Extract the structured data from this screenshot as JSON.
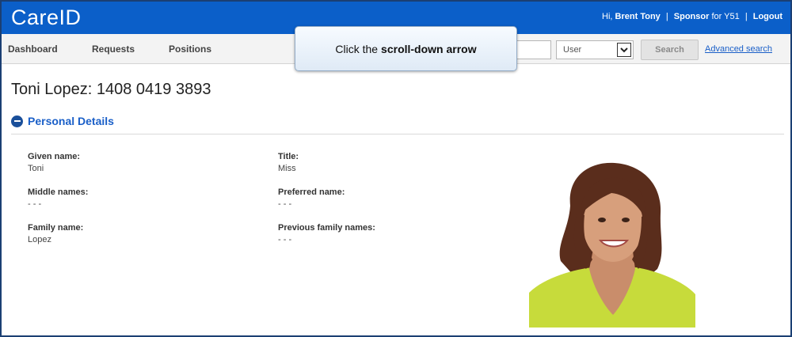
{
  "app": {
    "logo": "CareID"
  },
  "user": {
    "greeting": "Hi,",
    "name": "Brent Tony",
    "sep1": "|",
    "role_prefix": "Sponsor",
    "role_suffix": "for Y51",
    "sep2": "|",
    "logout": "Logout"
  },
  "nav": {
    "items": [
      {
        "label": "Dashboard"
      },
      {
        "label": "Requests"
      },
      {
        "label": "Positions"
      }
    ]
  },
  "search": {
    "input_value": "",
    "select_value": "User",
    "button_label": "Search",
    "advanced_link": "Advanced search"
  },
  "callout": {
    "prefix": "Click the",
    "emphasis": "scroll-down arrow"
  },
  "person": {
    "title": "Toni Lopez: 1408 0419 3893"
  },
  "section": {
    "label": "Personal Details"
  },
  "fields": {
    "given_name": {
      "label": "Given name:",
      "value": "Toni"
    },
    "title": {
      "label": "Title:",
      "value": "Miss"
    },
    "middle_names": {
      "label": "Middle names:",
      "value": "- - -"
    },
    "preferred_name": {
      "label": "Preferred name:",
      "value": "- - -"
    },
    "family_name": {
      "label": "Family name:",
      "value": "Lopez"
    },
    "previous_family_names": {
      "label": "Previous family names:",
      "value": "- - -"
    }
  },
  "colors": {
    "header_blue": "#0b5fc9",
    "link_blue": "#1a5fc8",
    "frame": "#1b3f73"
  },
  "icons": [
    "minus-circle-icon",
    "chevron-down-icon"
  ]
}
